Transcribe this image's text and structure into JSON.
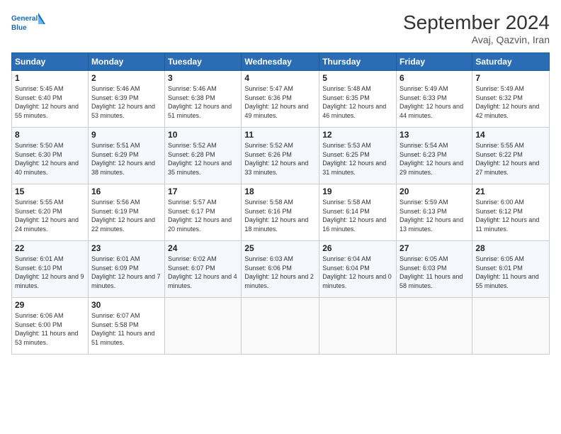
{
  "header": {
    "title": "September 2024",
    "location": "Avaj, Qazvin, Iran"
  },
  "logo": {
    "line1": "General",
    "line2": "Blue"
  },
  "weekdays": [
    "Sunday",
    "Monday",
    "Tuesday",
    "Wednesday",
    "Thursday",
    "Friday",
    "Saturday"
  ],
  "weeks": [
    [
      {
        "day": "1",
        "sunrise": "Sunrise: 5:45 AM",
        "sunset": "Sunset: 6:40 PM",
        "daylight": "Daylight: 12 hours and 55 minutes."
      },
      {
        "day": "2",
        "sunrise": "Sunrise: 5:46 AM",
        "sunset": "Sunset: 6:39 PM",
        "daylight": "Daylight: 12 hours and 53 minutes."
      },
      {
        "day": "3",
        "sunrise": "Sunrise: 5:46 AM",
        "sunset": "Sunset: 6:38 PM",
        "daylight": "Daylight: 12 hours and 51 minutes."
      },
      {
        "day": "4",
        "sunrise": "Sunrise: 5:47 AM",
        "sunset": "Sunset: 6:36 PM",
        "daylight": "Daylight: 12 hours and 49 minutes."
      },
      {
        "day": "5",
        "sunrise": "Sunrise: 5:48 AM",
        "sunset": "Sunset: 6:35 PM",
        "daylight": "Daylight: 12 hours and 46 minutes."
      },
      {
        "day": "6",
        "sunrise": "Sunrise: 5:49 AM",
        "sunset": "Sunset: 6:33 PM",
        "daylight": "Daylight: 12 hours and 44 minutes."
      },
      {
        "day": "7",
        "sunrise": "Sunrise: 5:49 AM",
        "sunset": "Sunset: 6:32 PM",
        "daylight": "Daylight: 12 hours and 42 minutes."
      }
    ],
    [
      {
        "day": "8",
        "sunrise": "Sunrise: 5:50 AM",
        "sunset": "Sunset: 6:30 PM",
        "daylight": "Daylight: 12 hours and 40 minutes."
      },
      {
        "day": "9",
        "sunrise": "Sunrise: 5:51 AM",
        "sunset": "Sunset: 6:29 PM",
        "daylight": "Daylight: 12 hours and 38 minutes."
      },
      {
        "day": "10",
        "sunrise": "Sunrise: 5:52 AM",
        "sunset": "Sunset: 6:28 PM",
        "daylight": "Daylight: 12 hours and 35 minutes."
      },
      {
        "day": "11",
        "sunrise": "Sunrise: 5:52 AM",
        "sunset": "Sunset: 6:26 PM",
        "daylight": "Daylight: 12 hours and 33 minutes."
      },
      {
        "day": "12",
        "sunrise": "Sunrise: 5:53 AM",
        "sunset": "Sunset: 6:25 PM",
        "daylight": "Daylight: 12 hours and 31 minutes."
      },
      {
        "day": "13",
        "sunrise": "Sunrise: 5:54 AM",
        "sunset": "Sunset: 6:23 PM",
        "daylight": "Daylight: 12 hours and 29 minutes."
      },
      {
        "day": "14",
        "sunrise": "Sunrise: 5:55 AM",
        "sunset": "Sunset: 6:22 PM",
        "daylight": "Daylight: 12 hours and 27 minutes."
      }
    ],
    [
      {
        "day": "15",
        "sunrise": "Sunrise: 5:55 AM",
        "sunset": "Sunset: 6:20 PM",
        "daylight": "Daylight: 12 hours and 24 minutes."
      },
      {
        "day": "16",
        "sunrise": "Sunrise: 5:56 AM",
        "sunset": "Sunset: 6:19 PM",
        "daylight": "Daylight: 12 hours and 22 minutes."
      },
      {
        "day": "17",
        "sunrise": "Sunrise: 5:57 AM",
        "sunset": "Sunset: 6:17 PM",
        "daylight": "Daylight: 12 hours and 20 minutes."
      },
      {
        "day": "18",
        "sunrise": "Sunrise: 5:58 AM",
        "sunset": "Sunset: 6:16 PM",
        "daylight": "Daylight: 12 hours and 18 minutes."
      },
      {
        "day": "19",
        "sunrise": "Sunrise: 5:58 AM",
        "sunset": "Sunset: 6:14 PM",
        "daylight": "Daylight: 12 hours and 16 minutes."
      },
      {
        "day": "20",
        "sunrise": "Sunrise: 5:59 AM",
        "sunset": "Sunset: 6:13 PM",
        "daylight": "Daylight: 12 hours and 13 minutes."
      },
      {
        "day": "21",
        "sunrise": "Sunrise: 6:00 AM",
        "sunset": "Sunset: 6:12 PM",
        "daylight": "Daylight: 12 hours and 11 minutes."
      }
    ],
    [
      {
        "day": "22",
        "sunrise": "Sunrise: 6:01 AM",
        "sunset": "Sunset: 6:10 PM",
        "daylight": "Daylight: 12 hours and 9 minutes."
      },
      {
        "day": "23",
        "sunrise": "Sunrise: 6:01 AM",
        "sunset": "Sunset: 6:09 PM",
        "daylight": "Daylight: 12 hours and 7 minutes."
      },
      {
        "day": "24",
        "sunrise": "Sunrise: 6:02 AM",
        "sunset": "Sunset: 6:07 PM",
        "daylight": "Daylight: 12 hours and 4 minutes."
      },
      {
        "day": "25",
        "sunrise": "Sunrise: 6:03 AM",
        "sunset": "Sunset: 6:06 PM",
        "daylight": "Daylight: 12 hours and 2 minutes."
      },
      {
        "day": "26",
        "sunrise": "Sunrise: 6:04 AM",
        "sunset": "Sunset: 6:04 PM",
        "daylight": "Daylight: 12 hours and 0 minutes."
      },
      {
        "day": "27",
        "sunrise": "Sunrise: 6:05 AM",
        "sunset": "Sunset: 6:03 PM",
        "daylight": "Daylight: 11 hours and 58 minutes."
      },
      {
        "day": "28",
        "sunrise": "Sunrise: 6:05 AM",
        "sunset": "Sunset: 6:01 PM",
        "daylight": "Daylight: 11 hours and 55 minutes."
      }
    ],
    [
      {
        "day": "29",
        "sunrise": "Sunrise: 6:06 AM",
        "sunset": "Sunset: 6:00 PM",
        "daylight": "Daylight: 11 hours and 53 minutes."
      },
      {
        "day": "30",
        "sunrise": "Sunrise: 6:07 AM",
        "sunset": "Sunset: 5:58 PM",
        "daylight": "Daylight: 11 hours and 51 minutes."
      },
      null,
      null,
      null,
      null,
      null
    ]
  ]
}
